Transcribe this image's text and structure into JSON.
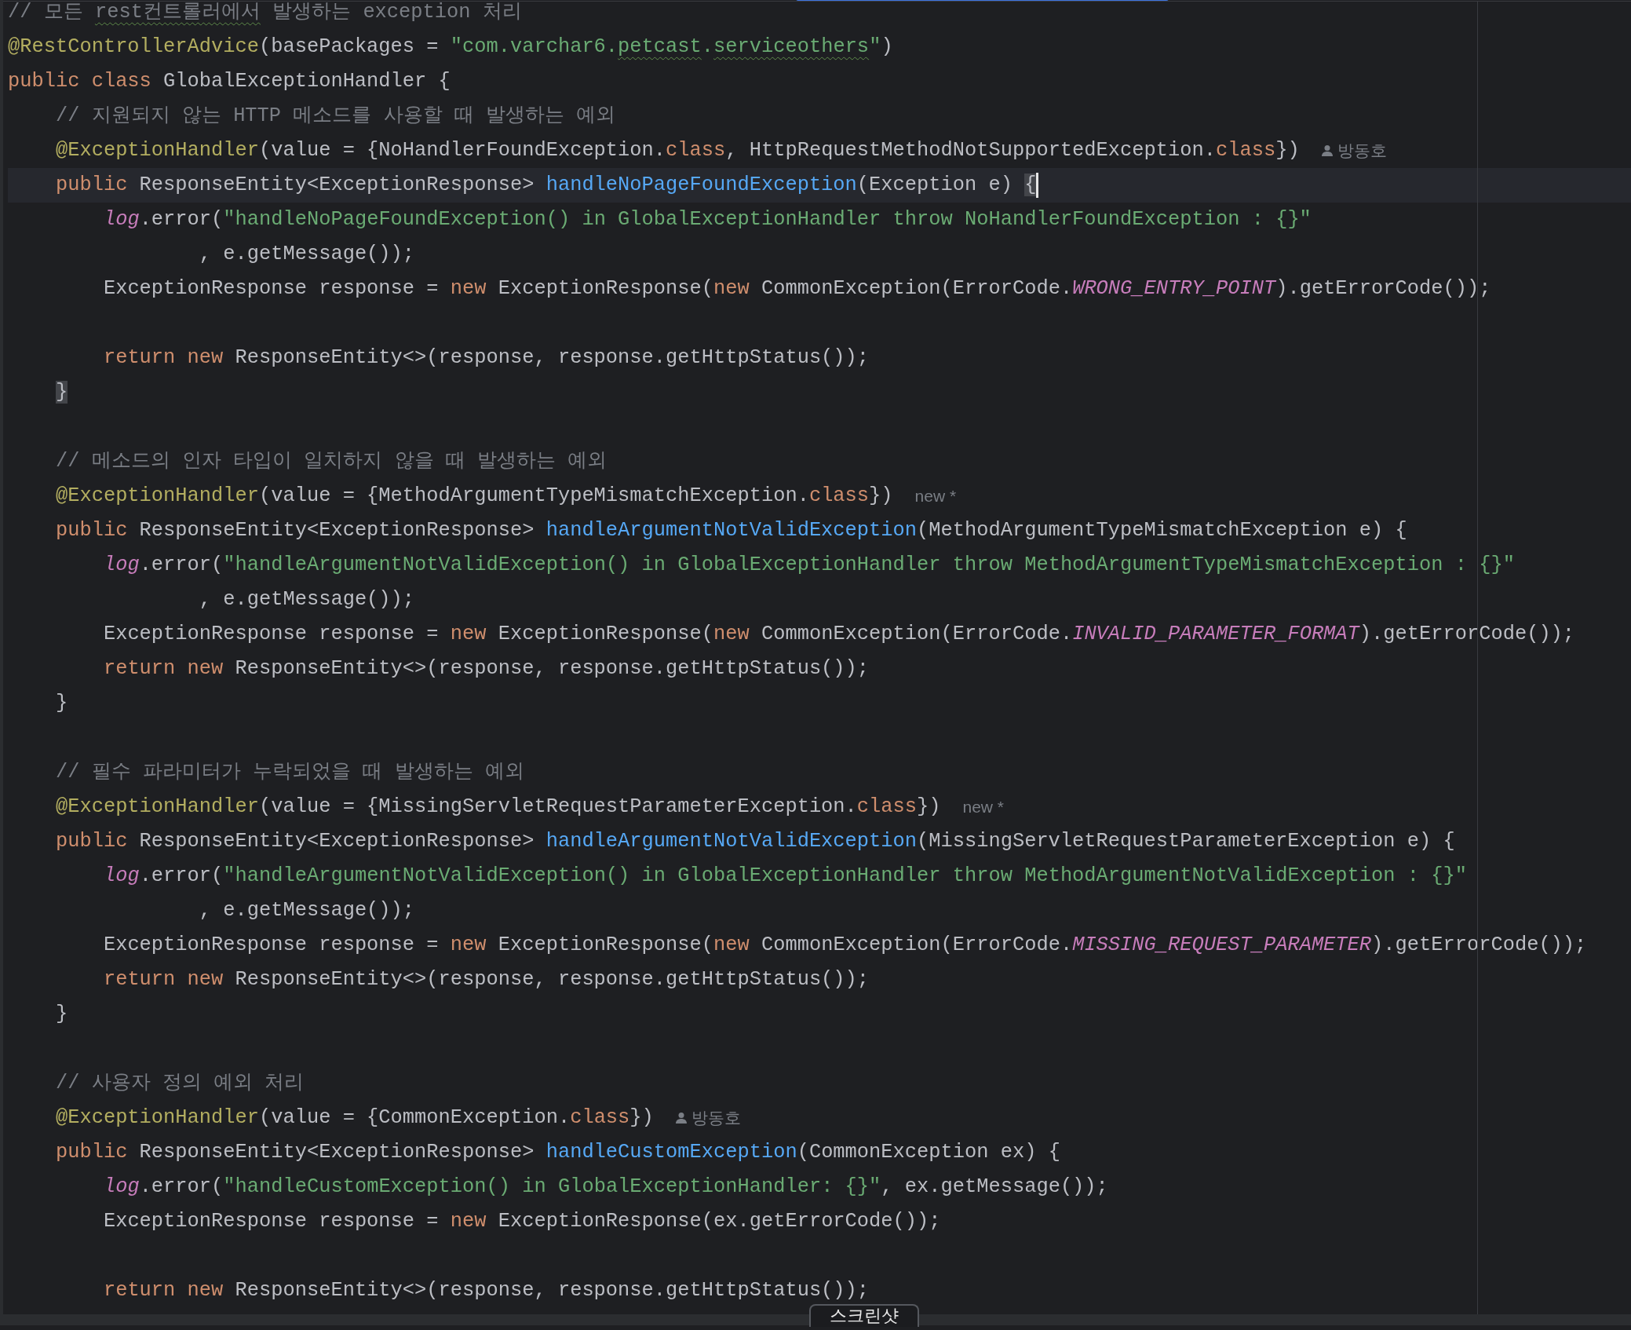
{
  "editor": {
    "lines": [
      {
        "kind": "code",
        "tokens": [
          {
            "kind": "comment",
            "text": "// 모든 "
          },
          {
            "kind": "comment-typo",
            "text": "rest컨트롤러에서"
          },
          {
            "kind": "comment",
            "text": " 발생하는 exception 처리"
          }
        ]
      },
      {
        "kind": "code",
        "tokens": [
          {
            "kind": "annotation",
            "text": "@RestControllerAdvice"
          },
          {
            "kind": "plain",
            "text": "(basePackages = "
          },
          {
            "kind": "string",
            "text": "\"com.varchar6."
          },
          {
            "kind": "string-typo",
            "text": "petcast"
          },
          {
            "kind": "string",
            "text": "."
          },
          {
            "kind": "string-typo",
            "text": "serviceothers"
          },
          {
            "kind": "string",
            "text": "\""
          },
          {
            "kind": "plain",
            "text": ")"
          }
        ]
      },
      {
        "kind": "code",
        "tokens": [
          {
            "kind": "keyword",
            "text": "public class"
          },
          {
            "kind": "plain",
            "text": " GlobalExceptionHandler {"
          }
        ]
      },
      {
        "kind": "code",
        "tokens": [
          {
            "kind": "comment",
            "text": "    // 지원되지 않는 HTTP 메소드를 사용할 때 발생하는 예외"
          }
        ]
      },
      {
        "kind": "code",
        "tokens": [
          {
            "kind": "annotation",
            "text": "    @ExceptionHandler"
          },
          {
            "kind": "plain",
            "text": "(value = {NoHandlerFoundException."
          },
          {
            "kind": "keyword",
            "text": "class"
          },
          {
            "kind": "plain",
            "text": ", HttpRequestMethodNotSupportedException."
          },
          {
            "kind": "keyword",
            "text": "class"
          },
          {
            "kind": "plain",
            "text": "})"
          }
        ],
        "hint": {
          "kind": "author",
          "text": "방동호"
        }
      },
      {
        "kind": "code",
        "current": true,
        "tokens": [
          {
            "kind": "keyword",
            "text": "    public"
          },
          {
            "kind": "plain",
            "text": " ResponseEntity<ExceptionResponse> "
          },
          {
            "kind": "method",
            "text": "handleNoPageFoundException"
          },
          {
            "kind": "plain",
            "text": "(Exception e) "
          },
          {
            "kind": "bracket",
            "text": "{"
          }
        ]
      },
      {
        "kind": "code",
        "tokens": [
          {
            "kind": "field",
            "text": "        log"
          },
          {
            "kind": "plain",
            "text": ".error("
          },
          {
            "kind": "string",
            "text": "\"handleNoPageFoundException() in GlobalExceptionHandler throw NoHandlerFoundException : {}\""
          }
        ]
      },
      {
        "kind": "code",
        "tokens": [
          {
            "kind": "plain",
            "text": "                , e.getMessage());"
          }
        ]
      },
      {
        "kind": "code",
        "tokens": [
          {
            "kind": "plain",
            "text": "        ExceptionResponse response = "
          },
          {
            "kind": "keyword",
            "text": "new"
          },
          {
            "kind": "plain",
            "text": " ExceptionResponse("
          },
          {
            "kind": "keyword",
            "text": "new"
          },
          {
            "kind": "plain",
            "text": " CommonException(ErrorCode."
          },
          {
            "kind": "field",
            "text": "WRONG_ENTRY_POINT"
          },
          {
            "kind": "plain",
            "text": ").getErrorCode());"
          }
        ]
      },
      {
        "kind": "blank"
      },
      {
        "kind": "code",
        "tokens": [
          {
            "kind": "keyword",
            "text": "        return new"
          },
          {
            "kind": "plain",
            "text": " ResponseEntity<>(response, response.getHttpStatus());"
          }
        ]
      },
      {
        "kind": "code",
        "tokens": [
          {
            "kind": "bracket",
            "text": "    }"
          }
        ]
      },
      {
        "kind": "blank"
      },
      {
        "kind": "code",
        "tokens": [
          {
            "kind": "comment",
            "text": "    // 메소드의 인자 타입이 일치하지 않을 때 발생하는 예외"
          }
        ]
      },
      {
        "kind": "code",
        "tokens": [
          {
            "kind": "annotation",
            "text": "    @ExceptionHandler"
          },
          {
            "kind": "plain",
            "text": "(value = {MethodArgumentTypeMismatchException."
          },
          {
            "kind": "keyword",
            "text": "class"
          },
          {
            "kind": "plain",
            "text": "})"
          }
        ],
        "hint": {
          "kind": "new",
          "text": "new *"
        }
      },
      {
        "kind": "code",
        "tokens": [
          {
            "kind": "keyword",
            "text": "    public"
          },
          {
            "kind": "plain",
            "text": " ResponseEntity<ExceptionResponse> "
          },
          {
            "kind": "method",
            "text": "handleArgumentNotValidException"
          },
          {
            "kind": "plain",
            "text": "(MethodArgumentTypeMismatchException e) {"
          }
        ]
      },
      {
        "kind": "code",
        "tokens": [
          {
            "kind": "field",
            "text": "        log"
          },
          {
            "kind": "plain",
            "text": ".error("
          },
          {
            "kind": "string",
            "text": "\"handleArgumentNotValidException() in GlobalExceptionHandler throw MethodArgumentTypeMismatchException : {}\""
          }
        ]
      },
      {
        "kind": "code",
        "tokens": [
          {
            "kind": "plain",
            "text": "                , e.getMessage());"
          }
        ]
      },
      {
        "kind": "code",
        "tokens": [
          {
            "kind": "plain",
            "text": "        ExceptionResponse response = "
          },
          {
            "kind": "keyword",
            "text": "new"
          },
          {
            "kind": "plain",
            "text": " ExceptionResponse("
          },
          {
            "kind": "keyword",
            "text": "new"
          },
          {
            "kind": "plain",
            "text": " CommonException(ErrorCode."
          },
          {
            "kind": "field",
            "text": "INVALID_PARAMETER_FORMAT"
          },
          {
            "kind": "plain",
            "text": ").getErrorCode());"
          }
        ]
      },
      {
        "kind": "code",
        "tokens": [
          {
            "kind": "keyword",
            "text": "        return new"
          },
          {
            "kind": "plain",
            "text": " ResponseEntity<>(response, response.getHttpStatus());"
          }
        ]
      },
      {
        "kind": "code",
        "tokens": [
          {
            "kind": "plain",
            "text": "    }"
          }
        ]
      },
      {
        "kind": "blank"
      },
      {
        "kind": "code",
        "tokens": [
          {
            "kind": "comment",
            "text": "    // 필수 파라미터가 누락되었을 때 발생하는 예외"
          }
        ]
      },
      {
        "kind": "code",
        "tokens": [
          {
            "kind": "annotation",
            "text": "    @ExceptionHandler"
          },
          {
            "kind": "plain",
            "text": "(value = {MissingServletRequestParameterException."
          },
          {
            "kind": "keyword",
            "text": "class"
          },
          {
            "kind": "plain",
            "text": "})"
          }
        ],
        "hint": {
          "kind": "new",
          "text": "new *"
        }
      },
      {
        "kind": "code",
        "tokens": [
          {
            "kind": "keyword",
            "text": "    public"
          },
          {
            "kind": "plain",
            "text": " ResponseEntity<ExceptionResponse> "
          },
          {
            "kind": "method",
            "text": "handleArgumentNotValidException"
          },
          {
            "kind": "plain",
            "text": "(MissingServletRequestParameterException e) {"
          }
        ]
      },
      {
        "kind": "code",
        "tokens": [
          {
            "kind": "field",
            "text": "        log"
          },
          {
            "kind": "plain",
            "text": ".error("
          },
          {
            "kind": "string",
            "text": "\"handleArgumentNotValidException() in GlobalExceptionHandler throw MethodArgumentNotValidException : {}\""
          }
        ]
      },
      {
        "kind": "code",
        "tokens": [
          {
            "kind": "plain",
            "text": "                , e.getMessage());"
          }
        ]
      },
      {
        "kind": "code",
        "tokens": [
          {
            "kind": "plain",
            "text": "        ExceptionResponse response = "
          },
          {
            "kind": "keyword",
            "text": "new"
          },
          {
            "kind": "plain",
            "text": " ExceptionResponse("
          },
          {
            "kind": "keyword",
            "text": "new"
          },
          {
            "kind": "plain",
            "text": " CommonException(ErrorCode."
          },
          {
            "kind": "field",
            "text": "MISSING_REQUEST_PARAMETER"
          },
          {
            "kind": "plain",
            "text": ").getErrorCode());"
          }
        ]
      },
      {
        "kind": "code",
        "tokens": [
          {
            "kind": "keyword",
            "text": "        return new"
          },
          {
            "kind": "plain",
            "text": " ResponseEntity<>(response, response.getHttpStatus());"
          }
        ]
      },
      {
        "kind": "code",
        "tokens": [
          {
            "kind": "plain",
            "text": "    }"
          }
        ]
      },
      {
        "kind": "blank"
      },
      {
        "kind": "code",
        "tokens": [
          {
            "kind": "comment",
            "text": "    // 사용자 정의 예외 처리"
          }
        ]
      },
      {
        "kind": "code",
        "tokens": [
          {
            "kind": "annotation",
            "text": "    @ExceptionHandler"
          },
          {
            "kind": "plain",
            "text": "(value = {CommonException."
          },
          {
            "kind": "keyword",
            "text": "class"
          },
          {
            "kind": "plain",
            "text": "})"
          }
        ],
        "hint": {
          "kind": "author",
          "text": "방동호"
        }
      },
      {
        "kind": "code",
        "tokens": [
          {
            "kind": "keyword",
            "text": "    public"
          },
          {
            "kind": "plain",
            "text": " ResponseEntity<ExceptionResponse> "
          },
          {
            "kind": "method",
            "text": "handleCustomException"
          },
          {
            "kind": "plain",
            "text": "(CommonException ex) {"
          }
        ]
      },
      {
        "kind": "code",
        "tokens": [
          {
            "kind": "field",
            "text": "        log"
          },
          {
            "kind": "plain",
            "text": ".error("
          },
          {
            "kind": "string",
            "text": "\"handleCustomException() in GlobalExceptionHandler: {}\""
          },
          {
            "kind": "plain",
            "text": ", ex.getMessage());"
          }
        ]
      },
      {
        "kind": "code",
        "tokens": [
          {
            "kind": "plain",
            "text": "        ExceptionResponse response = "
          },
          {
            "kind": "keyword",
            "text": "new"
          },
          {
            "kind": "plain",
            "text": " ExceptionResponse(ex.getErrorCode());"
          }
        ]
      },
      {
        "kind": "blank"
      },
      {
        "kind": "code",
        "tokens": [
          {
            "kind": "keyword",
            "text": "        return new"
          },
          {
            "kind": "plain",
            "text": " ResponseEntity<>(response, response.getHttpStatus());"
          }
        ]
      }
    ]
  },
  "tooltip": {
    "text": "스크린샷"
  }
}
